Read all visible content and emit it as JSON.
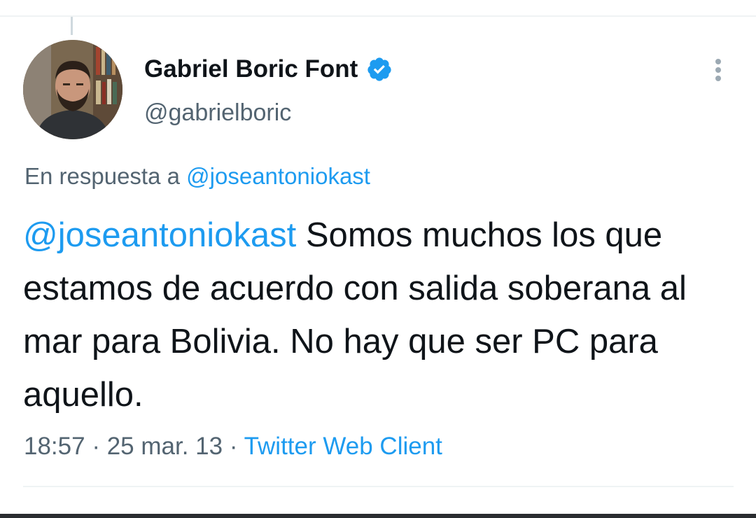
{
  "tweet": {
    "author": {
      "display_name": "Gabriel Boric Font",
      "handle": "@gabrielboric",
      "verified": true,
      "avatar": "avatar-photo"
    },
    "reply_prefix": "En respuesta a ",
    "reply_to_handle": "@joseantoniokast",
    "text_mention": "@joseantoniokast",
    "text_body": " Somos muchos los que estamos de acuerdo con salida soberana al mar para Bolivia. No hay que ser PC para aquello.",
    "time": "18:57",
    "separator": " · ",
    "date": "25 mar. 13",
    "source": "Twitter Web Client"
  },
  "icons": {
    "verified": "verified-badge-icon",
    "more": "more-vertical-icon"
  },
  "colors": {
    "link": "#1d9bf0",
    "secondary_text": "#536471",
    "primary_text": "#0f1419",
    "verified_badge": "#1d9bf0",
    "divider": "#eff3f4"
  }
}
